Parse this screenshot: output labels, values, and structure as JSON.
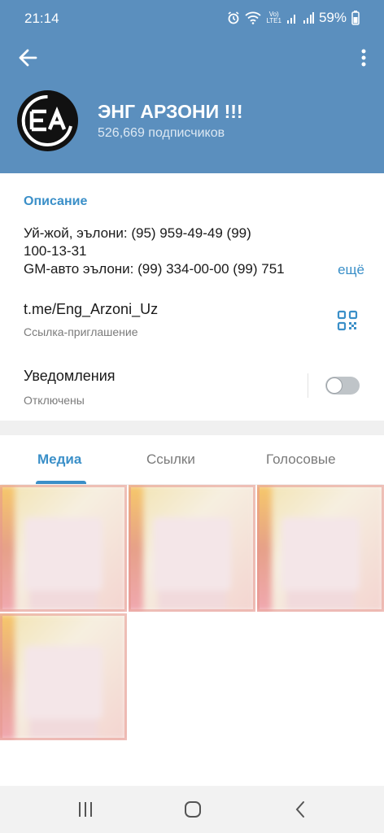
{
  "status_bar": {
    "time": "21:14",
    "battery": "59%",
    "icons": [
      "alarm-icon",
      "wifi-icon",
      "volte-icon",
      "signal-icon",
      "signal-icon",
      "battery-icon"
    ]
  },
  "header": {
    "back_icon": "arrow-left-icon",
    "menu_icon": "more-vertical-icon",
    "avatar_text": "EA",
    "title": "ЭНГ АРЗОНИ !!!",
    "subtitle": "526,669 подписчиков"
  },
  "info": {
    "description_label": "Описание",
    "description_lines": [
      "Уй-жой, эълони: (95) 959-49-49  (99)",
      "100-13-31",
      "GM-авто эълони: (99) 334-00-00  (99)  751"
    ],
    "more_label": "ещё",
    "link": "t.me/Eng_Arzoni_Uz",
    "link_sub": "Ссылка-приглашение",
    "notifications_title": "Уведомления",
    "notifications_sub": "Отключены",
    "notifications_on": false
  },
  "tabs": [
    {
      "label": "Медиа",
      "active": true
    },
    {
      "label": "Ссылки",
      "active": false
    },
    {
      "label": "Голосовые",
      "active": false
    }
  ],
  "media_count": 4,
  "nav": {
    "icons": [
      "recent-apps-icon",
      "home-icon",
      "back-icon"
    ]
  },
  "colors": {
    "header": "#5b8fbe",
    "accent": "#3a8fc8"
  }
}
